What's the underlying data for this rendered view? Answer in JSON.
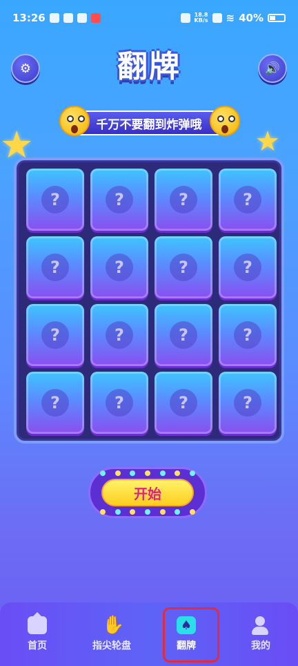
{
  "status_bar": {
    "time": "13:26",
    "net_speed_value": "18.8",
    "net_speed_unit": "KB/s",
    "battery": "40%"
  },
  "header": {
    "title": "翻牌",
    "settings_icon": "gear-icon",
    "sound_icon": "speaker-icon"
  },
  "banner": {
    "text": "千万不要翻到炸弹哦"
  },
  "board": {
    "card_symbol": "?",
    "cards": [
      "?",
      "?",
      "?",
      "?",
      "?",
      "?",
      "?",
      "?",
      "?",
      "?",
      "?",
      "?",
      "?",
      "?",
      "?",
      "?"
    ]
  },
  "start_button": {
    "label": "开始"
  },
  "tabbar": {
    "tabs": [
      {
        "label": "首页",
        "icon": "home-icon"
      },
      {
        "label": "指尖轮盘",
        "icon": "hand-icon"
      },
      {
        "label": "翻牌",
        "icon": "spade-card-icon"
      },
      {
        "label": "我的",
        "icon": "user-icon"
      }
    ],
    "active_index": 2
  },
  "colors": {
    "accent_yellow": "#ffe066",
    "start_text": "#e0208a",
    "active_outline": "#e02c3b"
  }
}
